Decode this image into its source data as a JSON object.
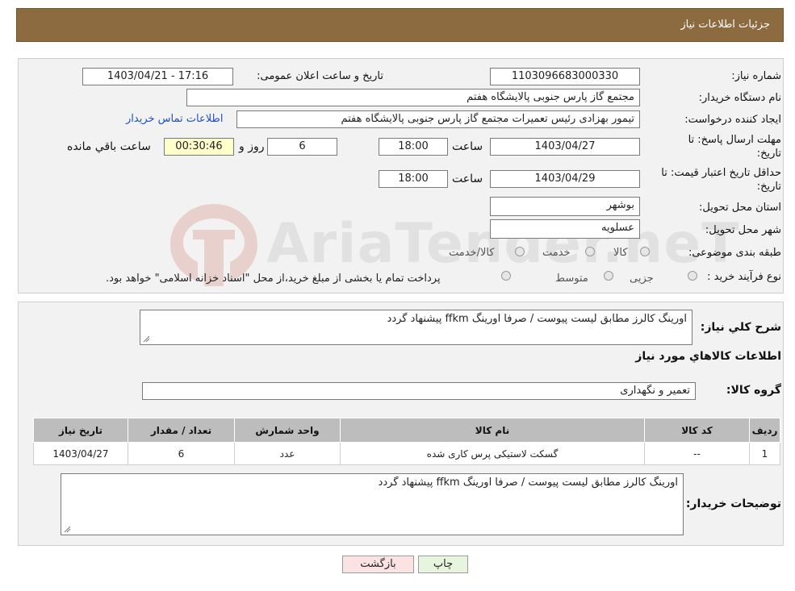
{
  "header": {
    "title": "جزئیات اطلاعات نیاز"
  },
  "form": {
    "need_number_label": "شماره نیاز:",
    "need_number": "1103096683000330",
    "announce_label": "تاریخ و ساعت اعلان عمومی:",
    "announce_value": "1403/04/21 - 17:16",
    "buyer_org_label": "نام دستگاه خریدار:",
    "buyer_org": "مجتمع گاز پارس جنوبی  پالایشگاه هفتم",
    "requester_label": "ایجاد کننده درخواست:",
    "requester": "تیمور بهزادی رئیس تعمیرات مجتمع گاز پارس جنوبی  پالایشگاه هفتم",
    "buyer_contact_link": "اطلاعات تماس خریدار",
    "deadline_label_1": "مهلت ارسال پاسخ: تا",
    "deadline_label_2": "تاریخ:",
    "deadline_date": "1403/04/27",
    "time_label": "ساعت",
    "deadline_time": "18:00",
    "days_value": "6",
    "days_label": "روز و",
    "remaining_time": "00:30:46",
    "remaining_label": "ساعت باقي مانده",
    "validity_label_1": "حداقل تاریخ اعتبار قیمت: تا",
    "validity_label_2": "تاریخ:",
    "validity_date": "1403/04/29",
    "validity_time": "18:00",
    "province_label": "استان محل تحویل:",
    "province": "بوشهر",
    "city_label": "شهر محل تحویل:",
    "city": "عسلویه",
    "category_label": "طبقه بندی موضوعی:",
    "category_options": [
      "کالا",
      "خدمت",
      "کالا/خدمت"
    ],
    "process_label": "نوع فرآیند خرید :",
    "process_options": [
      "جزیی",
      "متوسط"
    ],
    "process_note": "پرداخت تمام یا بخشی از مبلغ خرید،از محل \"اسناد خزانه اسلامی\" خواهد بود."
  },
  "details": {
    "desc_label": "شرح کلي نياز:",
    "desc_text": "اورینگ کالرز مطابق لیست پیوست / صرفا اورینگ ffkm پیشنهاد گردد",
    "goods_info_title": "اطلاعات کالاهاي مورد نياز",
    "goods_group_label": "گروه کالا:",
    "goods_group": "تعمیر و نگهداری",
    "table": {
      "headers": [
        "رديف",
        "کد کالا",
        "نام کالا",
        "واحد شمارش",
        "تعداد / مقدار",
        "تاریخ نیاز"
      ],
      "rows": [
        [
          "1",
          "--",
          "گسکت لاستیکی پرس کاری شده",
          "عدد",
          "6",
          "1403/04/27"
        ]
      ]
    },
    "buyer_notes_label": "توضیحات خریدار:",
    "buyer_notes": "اورینگ کالرز مطابق لیست پیوست / صرفا اورینگ ffkm پیشنهاد گردد"
  },
  "buttons": {
    "print": "چاپ",
    "back": "بازگشت"
  },
  "watermark": {
    "text": "AriaTender.neT"
  }
}
